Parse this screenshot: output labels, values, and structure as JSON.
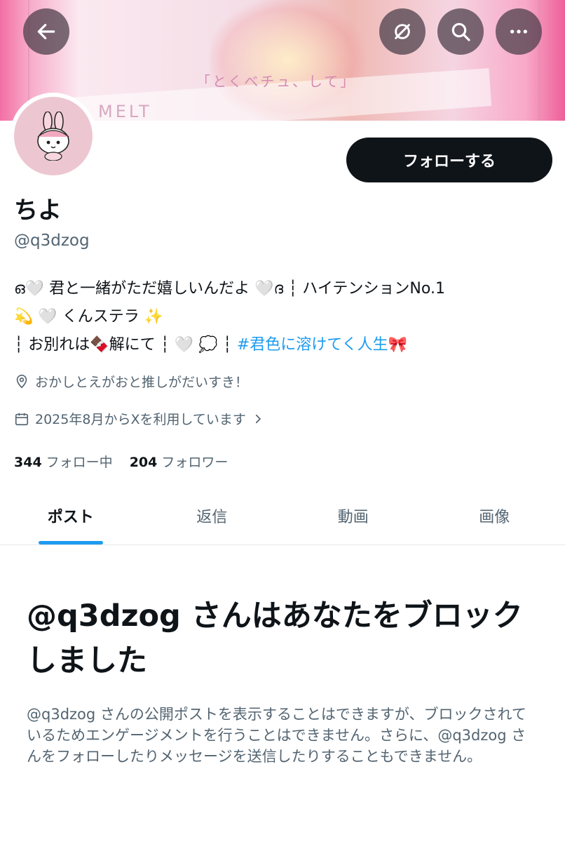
{
  "banner": {
    "caption": "「とくべチュ、して」",
    "watermark": "MELT"
  },
  "nav": {
    "back": "back-arrow-icon",
    "translate": "translate-icon",
    "search": "search-icon",
    "more": "more-icon"
  },
  "profile": {
    "name": "ちよ",
    "handle": "@q3dzog",
    "follow_label": "フォローする",
    "bio_lines": [
      "ഒ🤍 君と一緒がただ嬉しいんだよ 🤍ദ ┆ ハイテンションNo.1",
      "💫 🤍 くんステラ ✨",
      " ┆ お別れは🍫解にて ┆ 🤍 💭 ┆ "
    ],
    "bio_hashtag": "#君色に溶けてく人生🎀",
    "location": "おかしとえがおと推しがだいすき！",
    "joined": "2025年8月からXを利用しています",
    "following_count": "344",
    "following_label": "フォロー中",
    "followers_count": "204",
    "followers_label": "フォロワー"
  },
  "tabs": [
    "ポスト",
    "返信",
    "動画",
    "画像"
  ],
  "active_tab": 0,
  "blocked": {
    "title": "@q3dzog さんはあなたをブロックしました",
    "description": "@q3dzog さんの公開ポストを表示することはできますが、ブロックされているためエンゲージメントを行うことはできません。さらに、@q3dzog さんをフォローしたりメッセージを送信したりすることもできません。"
  },
  "colors": {
    "accent": "#1d9bf0",
    "text": "#0f1419",
    "muted": "#536471",
    "button": "#0f1419"
  }
}
